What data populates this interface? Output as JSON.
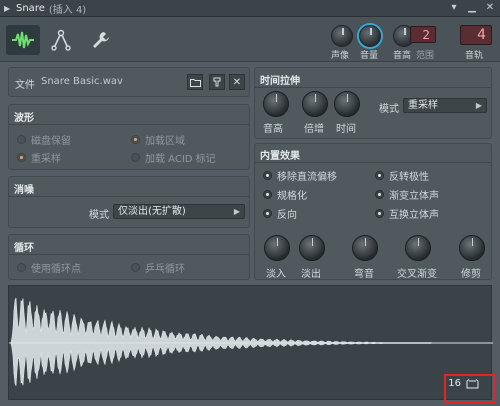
{
  "titlebar": {
    "title": "Snare",
    "subtitle": "(插入 4)"
  },
  "top": {
    "knobs": [
      {
        "label": "声像"
      },
      {
        "label": "音量"
      },
      {
        "label": "音高"
      }
    ],
    "range_value": "2",
    "range_label": "范围",
    "track_value": "4",
    "track_label": "音轨"
  },
  "file": {
    "label": "文件",
    "name": "Snare Basic.wav"
  },
  "waveform": {
    "title": "波形",
    "options": [
      {
        "label": "磁盘保留",
        "selected": false,
        "enabled": false
      },
      {
        "label": "加载区域",
        "selected": true,
        "enabled": false
      },
      {
        "label": "重采样",
        "selected": true,
        "enabled": false
      },
      {
        "label": "加载 ACID 标记",
        "selected": false,
        "enabled": false
      }
    ]
  },
  "declick": {
    "title": "消噪",
    "mode_label": "模式",
    "mode_value": "仅淡出(无扩散)"
  },
  "loop": {
    "title": "循环",
    "options": [
      {
        "label": "使用循环点",
        "enabled": false
      },
      {
        "label": "乒乓循环",
        "enabled": false
      }
    ]
  },
  "timestretch": {
    "title": "时间拉伸",
    "knobs": [
      "音高",
      "倍增",
      "时间"
    ],
    "mode_label": "模式",
    "mode_value": "重采样"
  },
  "fx": {
    "title": "内置效果",
    "options": [
      {
        "label": "移除直流偏移"
      },
      {
        "label": "反转极性"
      },
      {
        "label": "规格化"
      },
      {
        "label": "渐变立体声"
      },
      {
        "label": "反向"
      },
      {
        "label": "互换立体声"
      }
    ],
    "knobs": [
      "淡入",
      "淡出",
      "弯音",
      "交叉渐变",
      "修剪"
    ]
  },
  "wave_counter": "16",
  "colors": {
    "accent_blue": "#36a8d6",
    "accent_green": "#6fe06f",
    "counter_red": "#5a2d35",
    "highlight": "#e02626"
  }
}
